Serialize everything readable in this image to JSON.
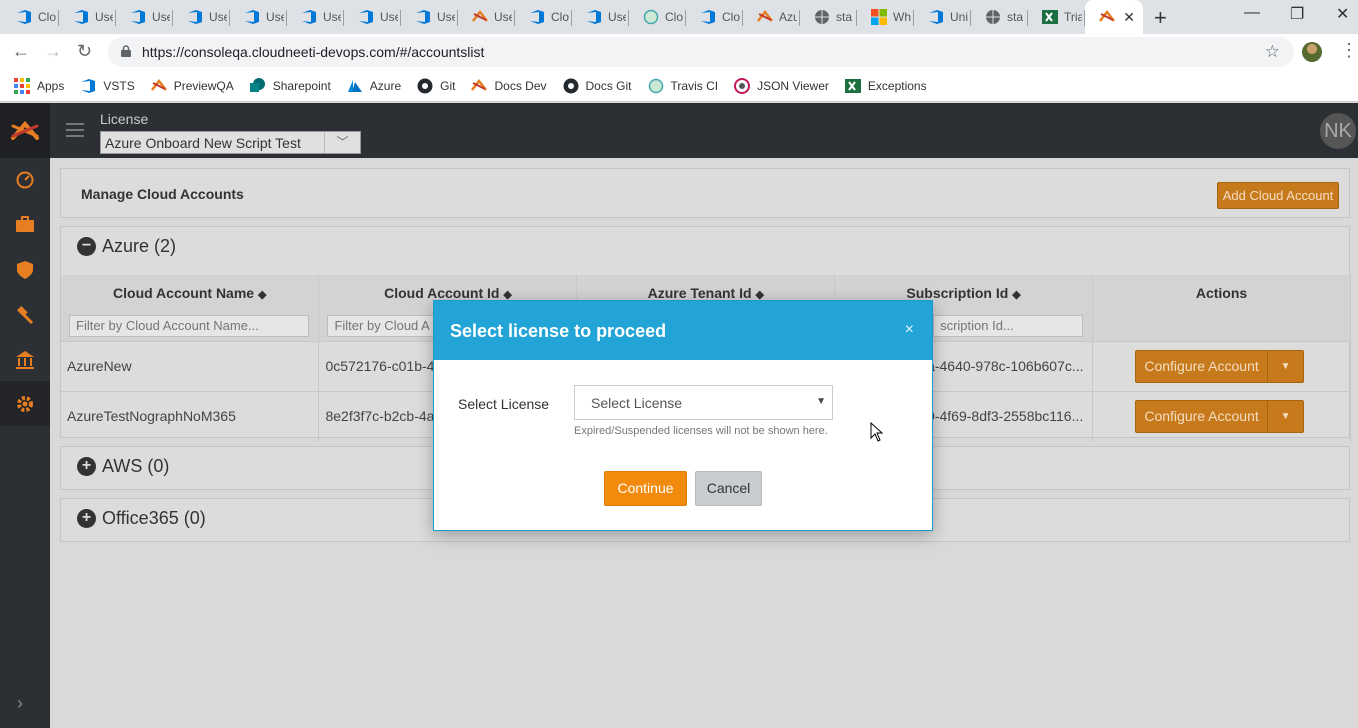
{
  "browser": {
    "tabs": [
      {
        "label": "Clo",
        "icon": "vsts-icon"
      },
      {
        "label": "Use",
        "icon": "vsts-icon"
      },
      {
        "label": "Use",
        "icon": "vsts-icon"
      },
      {
        "label": "Use",
        "icon": "vsts-icon"
      },
      {
        "label": "Use",
        "icon": "vsts-icon"
      },
      {
        "label": "Use",
        "icon": "vsts-icon"
      },
      {
        "label": "Use",
        "icon": "vsts-icon"
      },
      {
        "label": "Use",
        "icon": "vsts-icon"
      },
      {
        "label": "Use",
        "icon": "cloudneeti-icon"
      },
      {
        "label": "Clo",
        "icon": "vsts-icon"
      },
      {
        "label": "Use",
        "icon": "vsts-icon"
      },
      {
        "label": "Clo",
        "icon": "travis-icon"
      },
      {
        "label": "Clo",
        "icon": "vsts-icon"
      },
      {
        "label": "Azu",
        "icon": "cloudneeti-icon"
      },
      {
        "label": "sta",
        "icon": "globe-icon"
      },
      {
        "label": "Wh",
        "icon": "microsoft-icon"
      },
      {
        "label": "Uni",
        "icon": "vsts-icon"
      },
      {
        "label": "sta",
        "icon": "globe-icon"
      },
      {
        "label": "Tria",
        "icon": "excel-icon"
      },
      {
        "label": "",
        "icon": "cloudneeti-icon",
        "active": true
      }
    ],
    "url": "https://consoleqa.cloudneeti-devops.com/#/accountslist",
    "bookmarks": [
      {
        "label": "Apps",
        "icon": "apps-grid-icon"
      },
      {
        "label": "VSTS",
        "icon": "vsts-icon"
      },
      {
        "label": "PreviewQA",
        "icon": "cloudneeti-icon"
      },
      {
        "label": "Sharepoint",
        "icon": "sharepoint-icon"
      },
      {
        "label": "Azure",
        "icon": "azure-icon"
      },
      {
        "label": "Git",
        "icon": "github-icon"
      },
      {
        "label": "Docs Dev",
        "icon": "cloudneeti-icon"
      },
      {
        "label": "Docs Git",
        "icon": "github-icon"
      },
      {
        "label": "Travis CI",
        "icon": "travis-icon"
      },
      {
        "label": "JSON Viewer",
        "icon": "json-viewer-icon"
      },
      {
        "label": "Exceptions",
        "icon": "excel-icon"
      }
    ]
  },
  "header": {
    "license_label": "License",
    "license_value": "Azure Onboard New Script Test",
    "avatar_initials": "NK"
  },
  "manage": {
    "title": "Manage Cloud Accounts",
    "add_button": "Add Cloud Account"
  },
  "azure": {
    "title": "Azure (2)",
    "columns": [
      "Cloud Account Name",
      "Cloud Account Id",
      "Azure Tenant Id",
      "Subscription Id",
      "Actions"
    ],
    "filters": {
      "name": "Filter by Cloud Account Name...",
      "id": "Filter by Cloud A",
      "subscription": "scription Id..."
    },
    "rows": [
      {
        "name": "AzureNew",
        "account_id": "0c572176-c01b-4",
        "subscription": "a-4640-978c-106b607c...",
        "action": "Configure Account"
      },
      {
        "name": "AzureTestNographNoM365",
        "account_id": "8e2f3f7c-b2cb-4a",
        "subscription": "9-4f69-8df3-2558bc116...",
        "action": "Configure Account"
      }
    ]
  },
  "aws": {
    "title": "AWS (0)"
  },
  "office365": {
    "title": "Office365 (0)"
  },
  "modal": {
    "title": "Select license to proceed",
    "close": "×",
    "field_label": "Select License",
    "select_placeholder": "Select License",
    "hint": "Expired/Suspended licenses will not be shown here.",
    "continue": "Continue",
    "cancel": "Cancel"
  },
  "colors": {
    "accent_orange": "#f28a0e",
    "modal_header": "#22a5d6",
    "sidebar_bg": "#2c2f33"
  }
}
